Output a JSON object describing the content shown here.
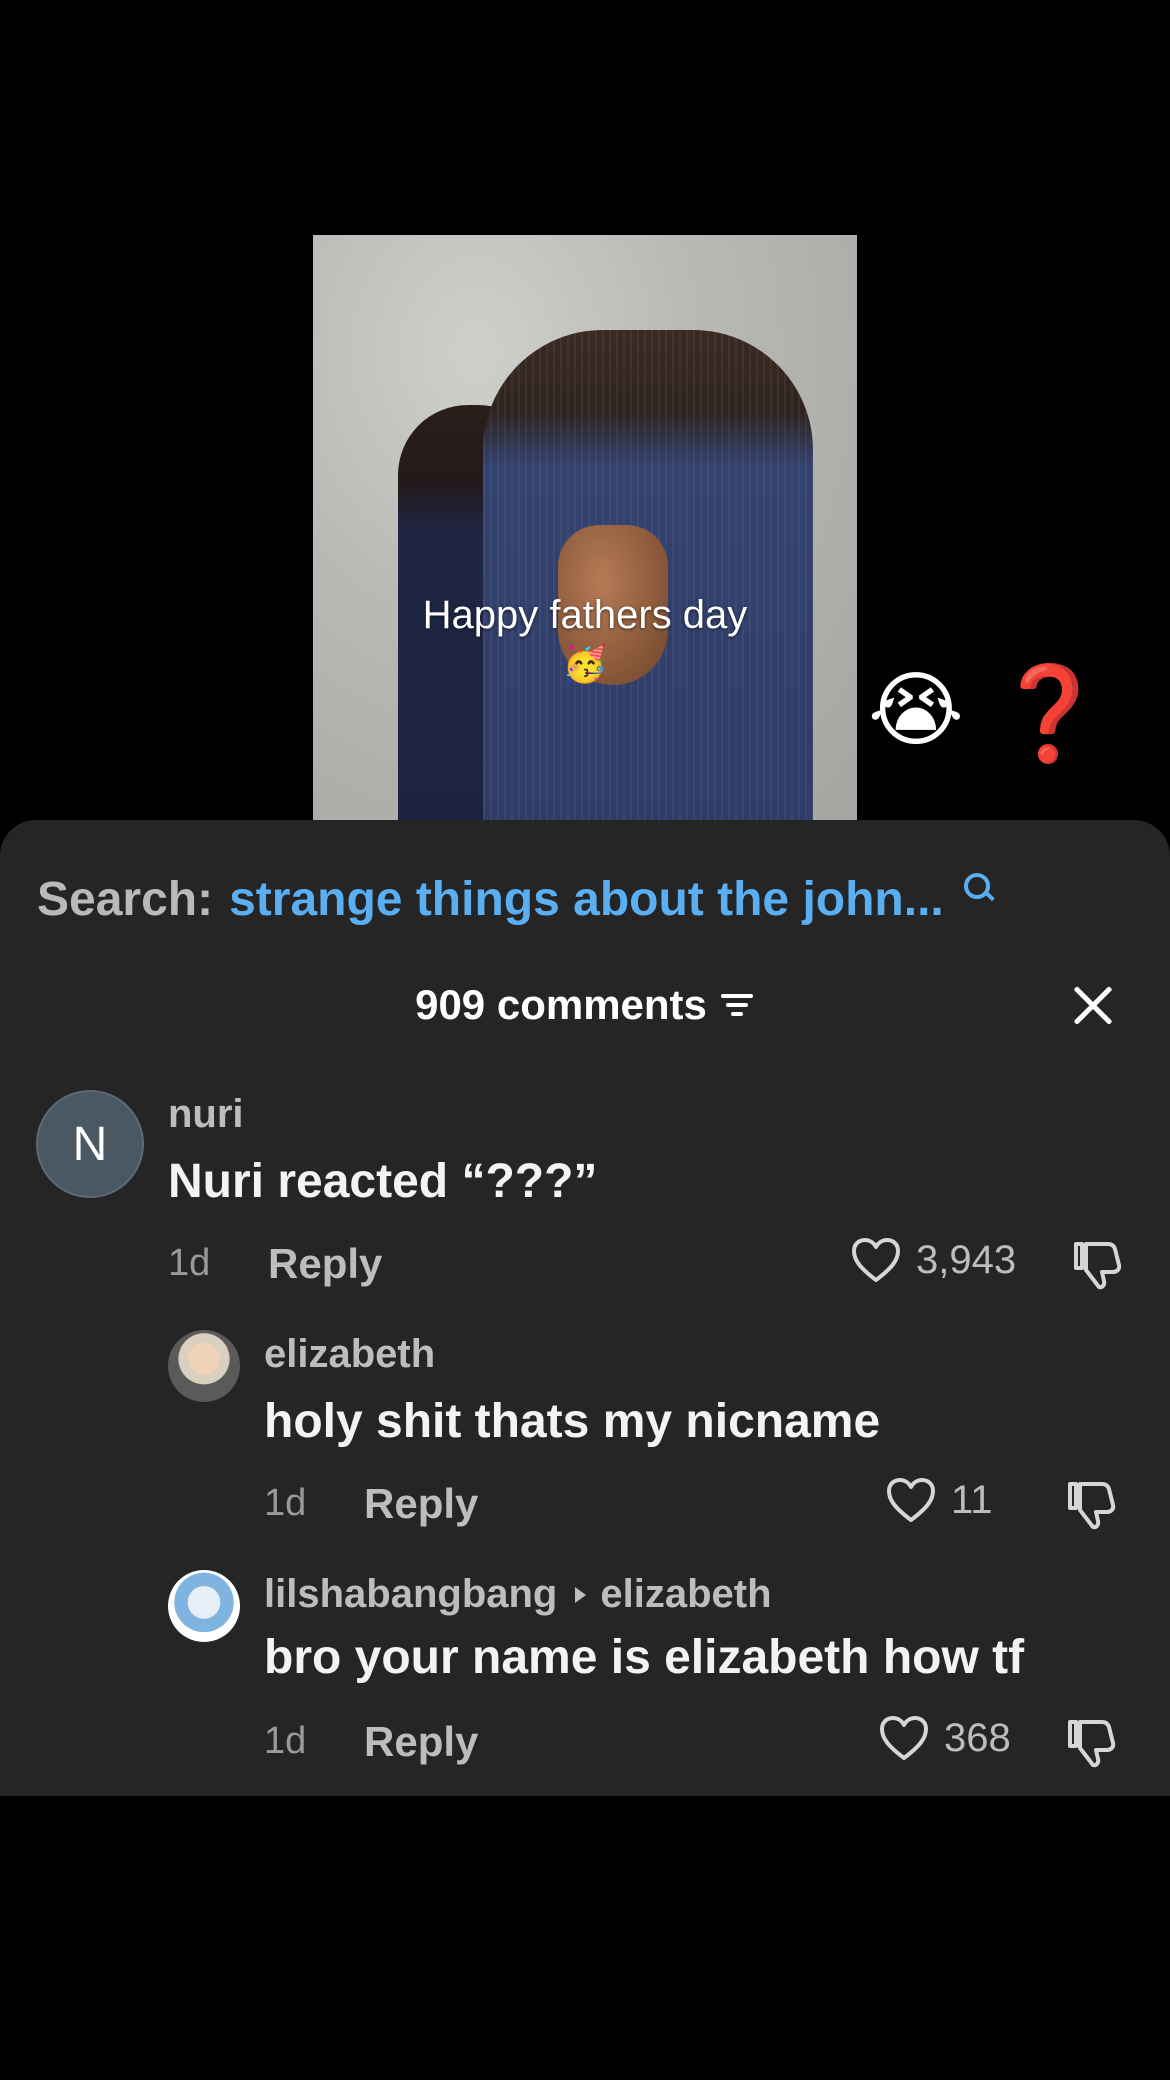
{
  "video": {
    "caption": "Happy fathers day",
    "caption_emoji": "🥳",
    "reaction_emoji": "😭",
    "reaction_mark": "❓"
  },
  "search": {
    "label": "Search:",
    "query": "strange things about the john..."
  },
  "comments_header": {
    "count_label": "909 comments"
  },
  "comments": [
    {
      "avatar_letter": "N",
      "username": "nuri",
      "text": "Nuri reacted “???”",
      "time": "1d",
      "reply_label": "Reply",
      "likes": "3,943"
    },
    {
      "username": "elizabeth",
      "text": "holy shit thats my nicname",
      "time": "1d",
      "reply_label": "Reply",
      "likes": "11"
    },
    {
      "username": "lilshabangbang",
      "reply_to": "elizabeth",
      "text": "bro your name is elizabeth how tf",
      "time": "1d",
      "reply_label": "Reply",
      "likes": "368"
    }
  ],
  "colors": {
    "sheet_bg": "#252525",
    "search_query": "#5aaef2",
    "muted_text": "#bdbdbd",
    "reaction_red": "#e3141e"
  }
}
